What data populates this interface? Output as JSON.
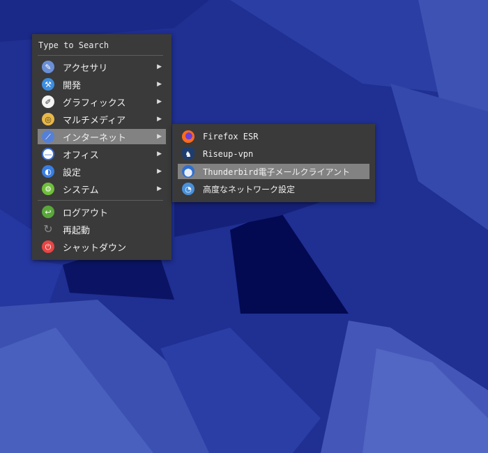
{
  "search": {
    "placeholder": "Type to Search"
  },
  "main_menu": {
    "categories": [
      {
        "label": "アクセサリ",
        "icon": "accessories-icon",
        "color": "#6b8fd6"
      },
      {
        "label": "開発",
        "icon": "development-icon",
        "color": "#3d8de0"
      },
      {
        "label": "グラフィックス",
        "icon": "graphics-icon",
        "color": "#f4f4f4"
      },
      {
        "label": "マルチメディア",
        "icon": "multimedia-icon",
        "color": "#e8b84a"
      },
      {
        "label": "インターネット",
        "icon": "internet-icon",
        "color": "#5580d8"
      },
      {
        "label": "オフィス",
        "icon": "office-icon",
        "color": "#3a6fd8"
      },
      {
        "label": "設定",
        "icon": "settings-icon",
        "color": "#3a7de0"
      },
      {
        "label": "システム",
        "icon": "system-icon",
        "color": "#6fbf3a"
      }
    ],
    "session": [
      {
        "label": "ログアウト",
        "icon": "logout-icon",
        "color": "#5aa83a"
      },
      {
        "label": "再起動",
        "icon": "restart-icon",
        "color": "#3a3a3a"
      },
      {
        "label": "シャットダウン",
        "icon": "shutdown-icon",
        "color": "#e84545"
      }
    ],
    "active_index": 4
  },
  "submenu": {
    "items": [
      {
        "label": "Firefox ESR",
        "icon": "firefox-icon",
        "color": "#ff6a1f"
      },
      {
        "label": "Riseup-vpn",
        "icon": "riseup-vpn-icon",
        "color": "#1e3d6e"
      },
      {
        "label": "Thunderbird電子メールクライアント",
        "icon": "thunderbird-icon",
        "color": "#2f6fcf"
      },
      {
        "label": "高度なネットワーク設定",
        "icon": "network-settings-icon",
        "color": "#4a90d9"
      }
    ],
    "active_index": 2
  },
  "colors": {
    "desktop_dark": "#0e1a78",
    "desktop_light": "#3f55b4",
    "menu_bg": "#3a3a3a",
    "highlight": "#828282"
  }
}
